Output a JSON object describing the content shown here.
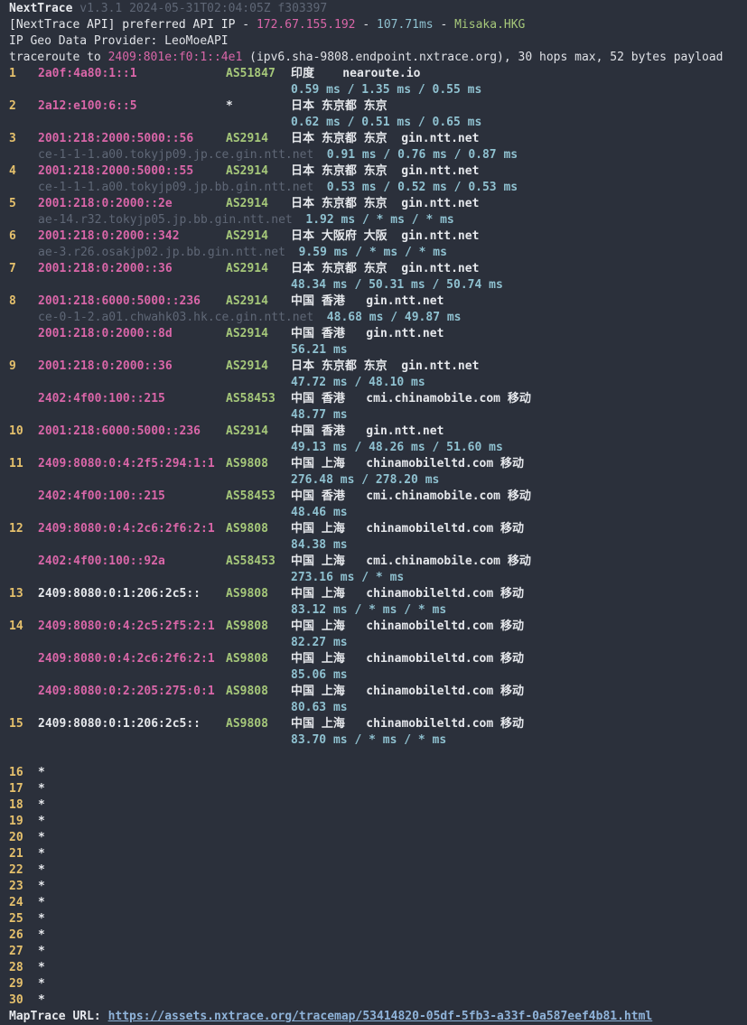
{
  "header": {
    "app_name": "NextTrace",
    "version_info": "v1.3.1 2024-05-31T02:04:05Z f303397",
    "api_prefix": "[NextTrace API] preferred API IP - ",
    "api_ip": "172.67.155.192",
    "api_sep1": " - ",
    "api_latency": "107.71ms",
    "api_sep2": " - ",
    "api_node": "Misaka.HKG",
    "geo_provider": "IP Geo Data Provider: LeoMoeAPI",
    "trace_prefix": "traceroute to ",
    "trace_target": "2409:801e:f0:1::4e1",
    "trace_suffix": " (ipv6.sha-9808.endpoint.nxtrace.org), 30 hops max, 52 bytes payload"
  },
  "hops": [
    {
      "num": "1",
      "entries": [
        {
          "ip": "2a0f:4a80:1::1",
          "ip_color": "pink",
          "asn": "AS51847",
          "geo": "印度    nearoute.io",
          "host": "",
          "rtt": "0.59 ms / 1.35 ms / 0.55 ms"
        }
      ]
    },
    {
      "num": "2",
      "entries": [
        {
          "ip": "2a12:e100:6::5",
          "ip_color": "pink",
          "asn": "*",
          "asn_white": true,
          "geo": "日本 东京都 东京",
          "host": "",
          "rtt": "0.62 ms / 0.51 ms / 0.65 ms"
        }
      ]
    },
    {
      "num": "3",
      "entries": [
        {
          "ip": "2001:218:2000:5000::56",
          "ip_color": "pink",
          "asn": "AS2914",
          "geo": "日本 东京都 东京  gin.ntt.net",
          "host": "ce-1-1-1.a00.tokyjp09.jp.ce.gin.ntt.net",
          "rtt": "0.91 ms / 0.76 ms / 0.87 ms",
          "rtt_inline": true
        }
      ]
    },
    {
      "num": "4",
      "entries": [
        {
          "ip": "2001:218:2000:5000::55",
          "ip_color": "pink",
          "asn": "AS2914",
          "geo": "日本 东京都 东京  gin.ntt.net",
          "host": "ce-1-1-1.a00.tokyjp09.jp.bb.gin.ntt.net",
          "rtt": "0.53 ms / 0.52 ms / 0.53 ms",
          "rtt_inline": true
        }
      ]
    },
    {
      "num": "5",
      "entries": [
        {
          "ip": "2001:218:0:2000::2e",
          "ip_color": "pink",
          "asn": "AS2914",
          "geo": "日本 东京都 东京  gin.ntt.net",
          "host": "ae-14.r32.tokyjp05.jp.bb.gin.ntt.net",
          "rtt": "1.92 ms / * ms / * ms",
          "rtt_inline": true
        }
      ]
    },
    {
      "num": "6",
      "entries": [
        {
          "ip": "2001:218:0:2000::342",
          "ip_color": "pink",
          "asn": "AS2914",
          "geo": "日本 大阪府 大阪  gin.ntt.net",
          "host": "ae-3.r26.osakjp02.jp.bb.gin.ntt.net",
          "rtt": "9.59 ms / * ms / * ms",
          "rtt_inline": true
        }
      ]
    },
    {
      "num": "7",
      "entries": [
        {
          "ip": "2001:218:0:2000::36",
          "ip_color": "pink",
          "asn": "AS2914",
          "geo": "日本 东京都 东京  gin.ntt.net",
          "host": "",
          "rtt": "48.34 ms / 50.31 ms / 50.74 ms"
        }
      ]
    },
    {
      "num": "8",
      "entries": [
        {
          "ip": "2001:218:6000:5000::236",
          "ip_color": "pink",
          "asn": "AS2914",
          "geo": "中国 香港   gin.ntt.net",
          "host": "ce-0-1-2.a01.chwahk03.hk.ce.gin.ntt.net",
          "rtt": "48.68 ms / 49.87 ms",
          "rtt_inline": true
        },
        {
          "ip": "2001:218:0:2000::8d",
          "ip_color": "pink",
          "asn": "AS2914",
          "geo": "中国 香港   gin.ntt.net",
          "host": "",
          "rtt": "56.21 ms"
        }
      ]
    },
    {
      "num": "9",
      "entries": [
        {
          "ip": "2001:218:0:2000::36",
          "ip_color": "pink",
          "asn": "AS2914",
          "geo": "日本 东京都 东京  gin.ntt.net",
          "host": "",
          "rtt": "47.72 ms / 48.10 ms"
        },
        {
          "ip": "2402:4f00:100::215",
          "ip_color": "pink",
          "asn": "AS58453",
          "geo": "中国 香港   cmi.chinamobile.com 移动",
          "host": "",
          "rtt": "48.77 ms"
        }
      ]
    },
    {
      "num": "10",
      "entries": [
        {
          "ip": "2001:218:6000:5000::236",
          "ip_color": "pink",
          "asn": "AS2914",
          "geo": "中国 香港   gin.ntt.net",
          "host": "",
          "rtt": "49.13 ms / 48.26 ms / 51.60 ms"
        }
      ]
    },
    {
      "num": "11",
      "entries": [
        {
          "ip": "2409:8080:0:4:2f5:294:1:1",
          "ip_color": "pink",
          "asn": "AS9808",
          "geo": "中国 上海   chinamobileltd.com 移动",
          "host": "",
          "rtt": "276.48 ms / 278.20 ms"
        },
        {
          "ip": "2402:4f00:100::215",
          "ip_color": "pink",
          "asn": "AS58453",
          "geo": "中国 香港   cmi.chinamobile.com 移动",
          "host": "",
          "rtt": "48.46 ms"
        }
      ]
    },
    {
      "num": "12",
      "entries": [
        {
          "ip": "2409:8080:0:4:2c6:2f6:2:1",
          "ip_color": "pink",
          "asn": "AS9808",
          "geo": "中国 上海   chinamobileltd.com 移动",
          "host": "",
          "rtt": "84.38 ms"
        },
        {
          "ip": "2402:4f00:100::92a",
          "ip_color": "pink",
          "asn": "AS58453",
          "geo": "中国 上海   cmi.chinamobile.com 移动",
          "host": "",
          "rtt": "273.16 ms / * ms"
        }
      ]
    },
    {
      "num": "13",
      "entries": [
        {
          "ip": "2409:8080:0:1:206:2c5::",
          "ip_color": "white",
          "asn": "AS9808",
          "geo": "中国 上海   chinamobileltd.com 移动",
          "host": "",
          "rtt": "83.12 ms / * ms / * ms"
        }
      ]
    },
    {
      "num": "14",
      "entries": [
        {
          "ip": "2409:8080:0:4:2c5:2f5:2:1",
          "ip_color": "pink",
          "asn": "AS9808",
          "geo": "中国 上海   chinamobileltd.com 移动",
          "host": "",
          "rtt": "82.27 ms"
        },
        {
          "ip": "2409:8080:0:4:2c6:2f6:2:1",
          "ip_color": "pink",
          "asn": "AS9808",
          "geo": "中国 上海   chinamobileltd.com 移动",
          "host": "",
          "rtt": "85.06 ms"
        },
        {
          "ip": "2409:8080:0:2:205:275:0:1",
          "ip_color": "pink",
          "asn": "AS9808",
          "geo": "中国 上海   chinamobileltd.com 移动",
          "host": "",
          "rtt": "80.63 ms"
        }
      ]
    },
    {
      "num": "15",
      "entries": [
        {
          "ip": "2409:8080:0:1:206:2c5::",
          "ip_color": "white",
          "asn": "AS9808",
          "geo": "中国 上海   chinamobileltd.com 移动",
          "host": "",
          "rtt": "83.70 ms / * ms / * ms"
        }
      ]
    }
  ],
  "timeout_hops": [
    {
      "num": "16",
      "mark": "*"
    },
    {
      "num": "17",
      "mark": "*"
    },
    {
      "num": "18",
      "mark": "*"
    },
    {
      "num": "19",
      "mark": "*"
    },
    {
      "num": "20",
      "mark": "*"
    },
    {
      "num": "21",
      "mark": "*"
    },
    {
      "num": "22",
      "mark": "*"
    },
    {
      "num": "23",
      "mark": "*"
    },
    {
      "num": "24",
      "mark": "*"
    },
    {
      "num": "25",
      "mark": "*"
    },
    {
      "num": "26",
      "mark": "*"
    },
    {
      "num": "27",
      "mark": "*"
    },
    {
      "num": "28",
      "mark": "*"
    },
    {
      "num": "29",
      "mark": "*"
    },
    {
      "num": "30",
      "mark": "*"
    }
  ],
  "footer": {
    "label": "MapTrace URL: ",
    "url": "https://assets.nxtrace.org/tracemap/53414820-05df-5fb3-a33f-0a587eef4b81.html"
  }
}
